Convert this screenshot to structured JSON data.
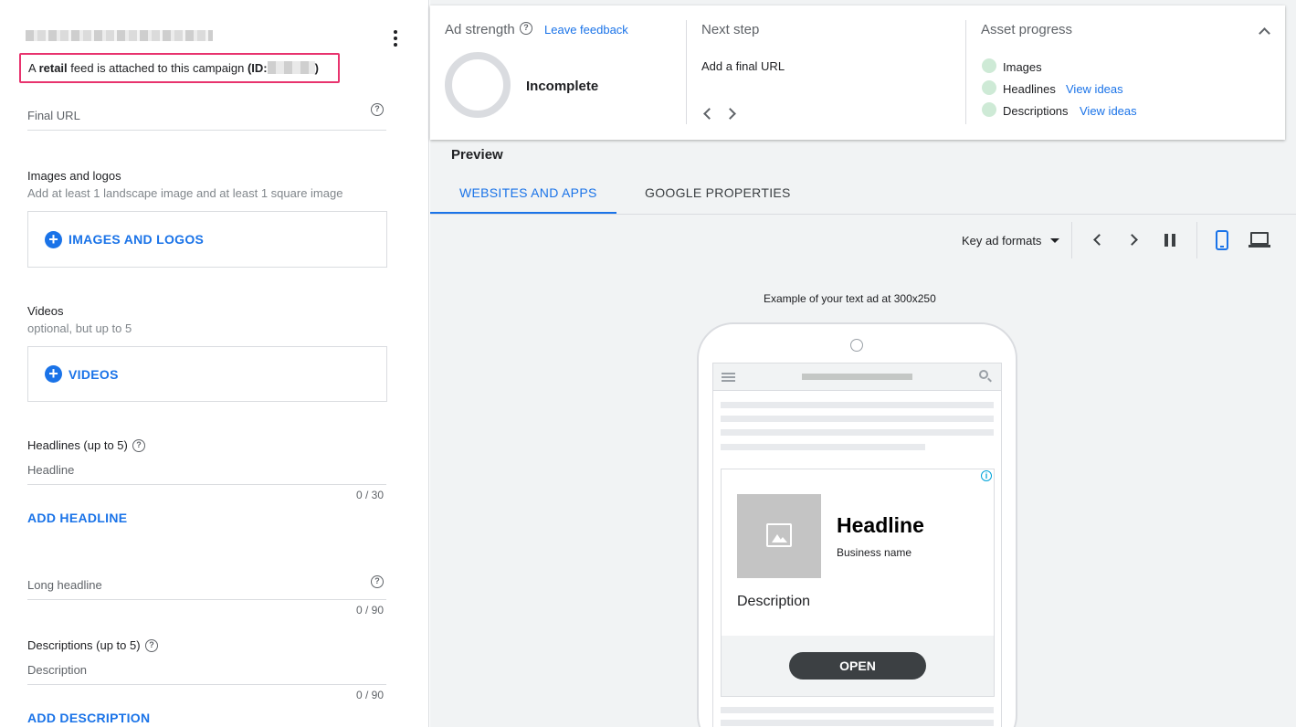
{
  "left": {
    "feed_notice": {
      "prefix": "A ",
      "bold_word": "retail",
      "middle": " feed is attached to this campaign ",
      "id_label": "(ID:",
      "suffix": ")"
    },
    "final_url": {
      "placeholder": "Final URL"
    },
    "images": {
      "title": "Images and logos",
      "subtitle": "Add at least 1 landscape image and at least 1 square image",
      "button": "IMAGES AND LOGOS"
    },
    "videos": {
      "title": "Videos",
      "subtitle": "optional, but up to 5",
      "button": "VIDEOS"
    },
    "headlines": {
      "title": "Headlines (up to 5)",
      "placeholder": "Headline",
      "counter": "0 / 30",
      "add_button": "ADD HEADLINE"
    },
    "long_headline": {
      "placeholder": "Long headline",
      "counter": "0 / 90"
    },
    "descriptions": {
      "title": "Descriptions (up to 5)",
      "placeholder": "Description",
      "counter": "0 / 90",
      "add_button": "ADD DESCRIPTION"
    }
  },
  "card": {
    "ad_strength": {
      "title": "Ad strength",
      "feedback_link": "Leave feedback",
      "status": "Incomplete"
    },
    "next_step": {
      "title": "Next step",
      "text": "Add a final URL"
    },
    "asset_progress": {
      "title": "Asset progress",
      "items": [
        {
          "label": "Images",
          "link": ""
        },
        {
          "label": "Headlines",
          "link": "View ideas"
        },
        {
          "label": "Descriptions",
          "link": "View ideas"
        }
      ]
    }
  },
  "preview": {
    "title": "Preview",
    "tabs": [
      {
        "label": "WEBSITES AND APPS",
        "active": true
      },
      {
        "label": "GOOGLE PROPERTIES",
        "active": false
      }
    ],
    "format_dropdown": "Key ad formats",
    "caption": "Example of your text ad at 300x250",
    "ad": {
      "headline": "Headline",
      "business_name": "Business name",
      "description": "Description",
      "cta": "OPEN"
    }
  },
  "colors": {
    "accent": "#1a73e8",
    "highlight_border": "#e8336e",
    "progress_dot": "#ceead6"
  }
}
